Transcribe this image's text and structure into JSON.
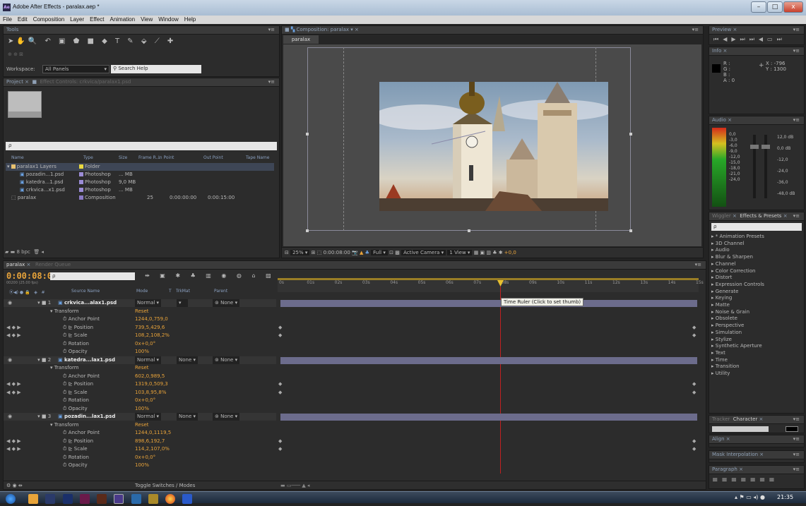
{
  "window": {
    "app_icon": "Ae",
    "title": "Adobe After Effects - paralax.aep *",
    "min": "–",
    "max": "□",
    "close": "x"
  },
  "menu": [
    "File",
    "Edit",
    "Composition",
    "Layer",
    "Effect",
    "Animation",
    "View",
    "Window",
    "Help"
  ],
  "tools": {
    "header": "Tools",
    "workspace_label": "Workspace:",
    "workspace_value": "All Panels",
    "search_placeholder": "Search Help"
  },
  "project": {
    "tab": "Project",
    "tab2": "Effect Controls: crkvica/paralax1.psd",
    "search_placeholder": "ρ",
    "columns": [
      "Name",
      "Type",
      "Size",
      "Frame R...",
      "In Point",
      "Out Point",
      "Tape Name"
    ],
    "items": [
      {
        "name": "paralax1 Layers",
        "type": "Folder",
        "size": "",
        "frame": "",
        "in": "",
        "out": ""
      },
      {
        "name": "pozadin...1.psd",
        "type": "Photoshop",
        "size": "... MB",
        "frame": "",
        "in": "",
        "out": ""
      },
      {
        "name": "katedra...1.psd",
        "type": "Photoshop",
        "size": "9,0 MB",
        "frame": "",
        "in": "",
        "out": ""
      },
      {
        "name": "crkvica...x1.psd",
        "type": "Photoshop",
        "size": "... MB",
        "frame": "",
        "in": "",
        "out": ""
      },
      {
        "name": "paralax",
        "type": "Composition",
        "size": "",
        "frame": "25",
        "in": "0:00:00:00",
        "out": "0:00:15:00"
      }
    ],
    "bpc": "8 bpc"
  },
  "composition": {
    "tab": "Composition: paralax",
    "subtab": "paralax",
    "zoom": "25%",
    "timecode": "0:00:08:00",
    "resolution": "Full",
    "camera": "Active Camera",
    "views": "1 View",
    "exposure": "+0,0"
  },
  "preview": {
    "tab": "Preview"
  },
  "info": {
    "tab": "Info",
    "r": "R :",
    "g": "G :",
    "b": "B :",
    "a": "A : 0",
    "x": "X : -796",
    "y": "Y : 1300"
  },
  "audio": {
    "tab": "Audio",
    "left": [
      "0,0",
      "-3,0",
      "-6,0",
      "-9,0",
      "-12,0",
      "-15,0",
      "-18,0",
      "-21,0",
      "-24,0"
    ],
    "right": [
      "12,0 dB",
      "0,0 dB",
      "-12,0",
      "-24,0",
      "-36,0",
      "-48,0 dB"
    ]
  },
  "effects": {
    "tab1": "Wiggler",
    "tab2": "Effects & Presets",
    "search_placeholder": "ρ",
    "items": [
      "* Animation Presets",
      "3D Channel",
      "Audio",
      "Blur & Sharpen",
      "Channel",
      "Color Correction",
      "Distort",
      "Expression Controls",
      "Generate",
      "Keying",
      "Matte",
      "Noise & Grain",
      "Obsolete",
      "Perspective",
      "Simulation",
      "Stylize",
      "Synthetic Aperture",
      "Text",
      "Time",
      "Transition",
      "Utility"
    ]
  },
  "side_panels": {
    "tracker": "Tracker",
    "character": "Character",
    "align": "Align",
    "mask": "Mask Interpolation",
    "paragraph": "Paragraph"
  },
  "timeline": {
    "tab": "paralax",
    "tab2": "Render Queue",
    "timecode": "0:00:08:00",
    "fps": "00200 (25.00 fps)",
    "search_placeholder": "ρ",
    "col_source": "Source Name",
    "col_mode": "Mode",
    "col_t": "T",
    "col_trkmat": "TrkMat",
    "col_parent": "Parent",
    "ruler": [
      "0s",
      "01s",
      "02s",
      "03s",
      "04s",
      "05s",
      "06s",
      "07s",
      "08s",
      "09s",
      "10s",
      "11s",
      "12s",
      "13s",
      "14s",
      "15s"
    ],
    "tooltip": "Time Ruler (Click to set thumb)",
    "toggle": "Toggle Switches / Modes",
    "layers": [
      {
        "num": "1",
        "name": "crkvica...alax1.psd",
        "mode": "Normal",
        "trkmat": "",
        "parent": "None",
        "transform": "Transform",
        "reset": "Reset",
        "props": [
          [
            "Anchor Point",
            "1244,0,759,0"
          ],
          [
            "Position",
            "739,5,429,6"
          ],
          [
            "Scale",
            "108,2,108,2%"
          ],
          [
            "Rotation",
            "0x+0,0°"
          ],
          [
            "Opacity",
            "100%"
          ]
        ]
      },
      {
        "num": "2",
        "name": "katedra...lax1.psd",
        "mode": "Normal",
        "trkmat": "None",
        "parent": "None",
        "transform": "Transform",
        "reset": "Reset",
        "props": [
          [
            "Anchor Point",
            "602,0,989,5"
          ],
          [
            "Position",
            "1319,0,509,3"
          ],
          [
            "Scale",
            "103,8,95,8%"
          ],
          [
            "Rotation",
            "0x+0,0°"
          ],
          [
            "Opacity",
            "100%"
          ]
        ]
      },
      {
        "num": "3",
        "name": "pozadin...lax1.psd",
        "mode": "Normal",
        "trkmat": "None",
        "parent": "None",
        "transform": "Transform",
        "reset": "Reset",
        "props": [
          [
            "Anchor Point",
            "1244,0,1119,5"
          ],
          [
            "Position",
            "898,6,192,7"
          ],
          [
            "Scale",
            "114,2,107,0%"
          ],
          [
            "Rotation",
            "0x+0,0°"
          ],
          [
            "Opacity",
            "100%"
          ]
        ]
      }
    ]
  },
  "taskbar": {
    "clock": "21:35"
  }
}
